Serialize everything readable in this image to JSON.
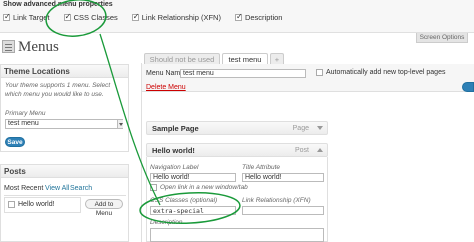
{
  "screen_options": {
    "heading": "Show advanced menu properties",
    "options": [
      {
        "label": "Link Target",
        "checked": true
      },
      {
        "label": "CSS Classes",
        "checked": true
      },
      {
        "label": "Link Relationship (XFN)",
        "checked": true
      },
      {
        "label": "Description",
        "checked": true
      }
    ],
    "tab_label": "Screen Options"
  },
  "page": {
    "title": "Menus"
  },
  "tabs": [
    {
      "label": "Should not be used"
    },
    {
      "label": "test menu"
    },
    {
      "label": "+"
    }
  ],
  "theme_locations": {
    "title": "Theme Locations",
    "description": "Your theme supports 1 menu. Select which menu you would like to use.",
    "primary_label": "Primary Menu",
    "primary_value": "test menu",
    "save_label": "Save"
  },
  "posts": {
    "title": "Posts",
    "tabs": [
      "Most Recent",
      "View All",
      "Search"
    ],
    "items": [
      {
        "label": "Hello world!",
        "checked": false
      }
    ],
    "add_button": "Add to Menu"
  },
  "menu_settings": {
    "name_label": "Menu Name",
    "name_value": "test menu",
    "auto_add_label": "Automatically add new top-level pages",
    "delete_label": "Delete Menu"
  },
  "menu_items": [
    {
      "title": "Sample Page",
      "type": "Page"
    },
    {
      "title": "Hello world!",
      "type": "Post"
    }
  ],
  "item_fields": {
    "nav_label": "Navigation Label",
    "nav_value": "Hello world!",
    "title_attr_label": "Title Attribute",
    "title_attr_value": "Hello world!",
    "open_new_window": "Open link in a new window/tab",
    "css_label": "CSS Classes (optional)",
    "css_value": "extra-special",
    "xfn_label": "Link Relationship (XFN)",
    "description_label": "Description"
  },
  "colors": {
    "annotation": "#1a9a3a",
    "delete": "#cc0000",
    "primary_button": "#2e80b6"
  }
}
